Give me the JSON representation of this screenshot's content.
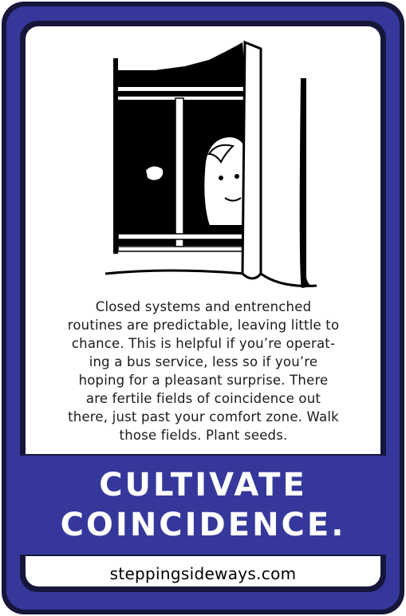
{
  "card": {
    "body_lines": [
      "Closed systems and entrenched",
      "routines are predictable, leaving little to",
      "chance. This is helpful if you’re operat-",
      "ing a bus service, less so if you’re",
      "hoping for a pleasant surprise. There",
      "are fertile fields of coincidence out",
      "there, just past your comfort zone. Walk",
      "those fields. Plant seeds."
    ],
    "title_lines": [
      "CULTIVATE",
      "COINCIDENCE."
    ],
    "website": "steppingsideways.com"
  },
  "colors": {
    "frame_blue": "#35389a",
    "frame_dark": "#16163a",
    "panel_white": "#ffffff",
    "ink": "#000000"
  },
  "illustration": {
    "icon": "window-peeking-girl-illustration"
  }
}
